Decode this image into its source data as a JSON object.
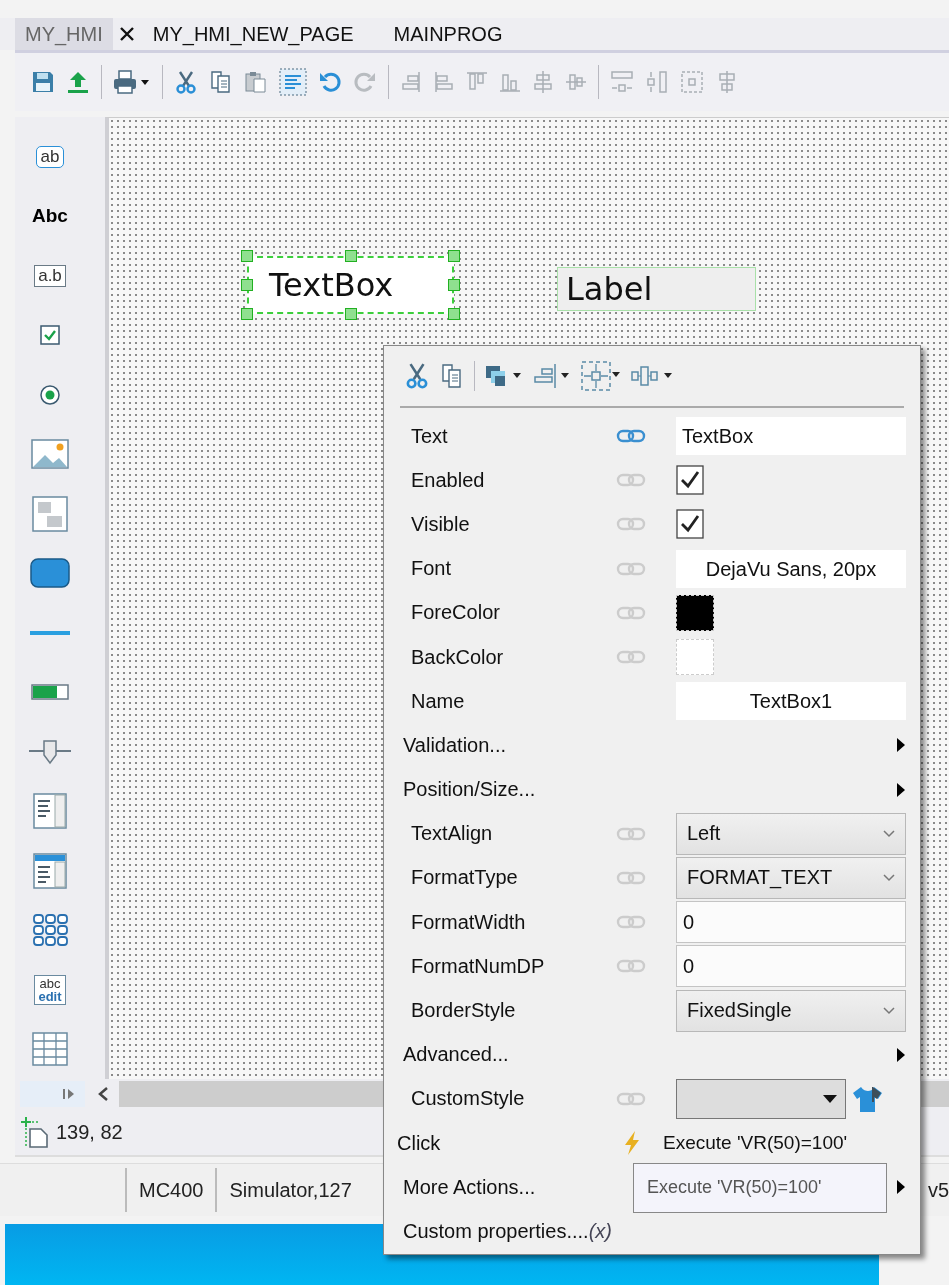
{
  "tabs": [
    {
      "label": "MY_HMI",
      "selected": true
    },
    {
      "label": "MY_HMI_NEW_PAGE",
      "selected": false
    },
    {
      "label": "MAINPROG",
      "selected": false
    }
  ],
  "palette": [
    {
      "kind": "textbox",
      "label": "ab"
    },
    {
      "kind": "label",
      "label": "Abc"
    },
    {
      "kind": "input",
      "label": "a.b"
    },
    {
      "kind": "checkbox"
    },
    {
      "kind": "radio"
    },
    {
      "kind": "image"
    },
    {
      "kind": "panel"
    },
    {
      "kind": "button"
    },
    {
      "kind": "line"
    },
    {
      "kind": "progress"
    },
    {
      "kind": "slider"
    },
    {
      "kind": "listbox"
    },
    {
      "kind": "combobox"
    },
    {
      "kind": "keypad"
    },
    {
      "kind": "editor",
      "label": "abc",
      "sublabel": "edit"
    },
    {
      "kind": "grid"
    }
  ],
  "canvas": {
    "widgets": [
      {
        "kind": "textbox",
        "text": "TextBox",
        "selected": true
      },
      {
        "kind": "label",
        "text": "Label",
        "selected": false
      }
    ]
  },
  "coordinates": "139, 82",
  "status_bar": [
    "MC400",
    "Simulator,127",
    "v5"
  ],
  "properties": [
    {
      "kind": "input",
      "label": "Text",
      "bound": true,
      "value": "TextBox"
    },
    {
      "kind": "check",
      "label": "Enabled",
      "bound": false,
      "checked": true
    },
    {
      "kind": "check",
      "label": "Visible",
      "bound": false,
      "checked": true
    },
    {
      "kind": "value",
      "label": "Font",
      "bound": false,
      "value": "DejaVu Sans, 20px"
    },
    {
      "kind": "color",
      "label": "ForeColor",
      "bound": false,
      "color": "#000000"
    },
    {
      "kind": "color",
      "label": "BackColor",
      "bound": false,
      "color": "#ffffff"
    },
    {
      "kind": "value",
      "label": "Name",
      "value": "TextBox1"
    },
    {
      "kind": "section",
      "label": "Validation..."
    },
    {
      "kind": "section",
      "label": "Position/Size..."
    },
    {
      "kind": "select",
      "label": "TextAlign",
      "bound": false,
      "value": "Left"
    },
    {
      "kind": "select",
      "label": "FormatType",
      "bound": false,
      "value": "FORMAT_TEXT"
    },
    {
      "kind": "number",
      "label": "FormatWidth",
      "bound": false,
      "value": "0"
    },
    {
      "kind": "number",
      "label": "FormatNumDP",
      "bound": false,
      "value": "0"
    },
    {
      "kind": "select",
      "label": "BorderStyle",
      "value": "FixedSingle"
    },
    {
      "kind": "section",
      "label": "Advanced..."
    },
    {
      "kind": "combo",
      "label": "CustomStyle",
      "bound": false
    },
    {
      "kind": "event",
      "label": "Click",
      "value": "Execute 'VR(50)=100'"
    },
    {
      "kind": "section",
      "label": "More Actions..."
    },
    {
      "kind": "custom",
      "label": "Custom properties....",
      "suffix": "(x)"
    }
  ],
  "tooltip": "Execute 'VR(50)=100'"
}
